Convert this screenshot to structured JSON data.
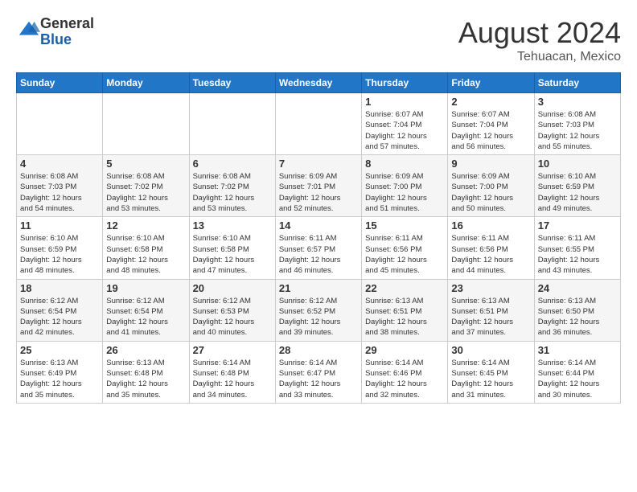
{
  "header": {
    "logo_general": "General",
    "logo_blue": "Blue",
    "title": "August 2024",
    "location": "Tehuacan, Mexico"
  },
  "weekdays": [
    "Sunday",
    "Monday",
    "Tuesday",
    "Wednesday",
    "Thursday",
    "Friday",
    "Saturday"
  ],
  "weeks": [
    [
      {
        "day": "",
        "info": ""
      },
      {
        "day": "",
        "info": ""
      },
      {
        "day": "",
        "info": ""
      },
      {
        "day": "",
        "info": ""
      },
      {
        "day": "1",
        "info": "Sunrise: 6:07 AM\nSunset: 7:04 PM\nDaylight: 12 hours\nand 57 minutes."
      },
      {
        "day": "2",
        "info": "Sunrise: 6:07 AM\nSunset: 7:04 PM\nDaylight: 12 hours\nand 56 minutes."
      },
      {
        "day": "3",
        "info": "Sunrise: 6:08 AM\nSunset: 7:03 PM\nDaylight: 12 hours\nand 55 minutes."
      }
    ],
    [
      {
        "day": "4",
        "info": "Sunrise: 6:08 AM\nSunset: 7:03 PM\nDaylight: 12 hours\nand 54 minutes."
      },
      {
        "day": "5",
        "info": "Sunrise: 6:08 AM\nSunset: 7:02 PM\nDaylight: 12 hours\nand 53 minutes."
      },
      {
        "day": "6",
        "info": "Sunrise: 6:08 AM\nSunset: 7:02 PM\nDaylight: 12 hours\nand 53 minutes."
      },
      {
        "day": "7",
        "info": "Sunrise: 6:09 AM\nSunset: 7:01 PM\nDaylight: 12 hours\nand 52 minutes."
      },
      {
        "day": "8",
        "info": "Sunrise: 6:09 AM\nSunset: 7:00 PM\nDaylight: 12 hours\nand 51 minutes."
      },
      {
        "day": "9",
        "info": "Sunrise: 6:09 AM\nSunset: 7:00 PM\nDaylight: 12 hours\nand 50 minutes."
      },
      {
        "day": "10",
        "info": "Sunrise: 6:10 AM\nSunset: 6:59 PM\nDaylight: 12 hours\nand 49 minutes."
      }
    ],
    [
      {
        "day": "11",
        "info": "Sunrise: 6:10 AM\nSunset: 6:59 PM\nDaylight: 12 hours\nand 48 minutes."
      },
      {
        "day": "12",
        "info": "Sunrise: 6:10 AM\nSunset: 6:58 PM\nDaylight: 12 hours\nand 48 minutes."
      },
      {
        "day": "13",
        "info": "Sunrise: 6:10 AM\nSunset: 6:58 PM\nDaylight: 12 hours\nand 47 minutes."
      },
      {
        "day": "14",
        "info": "Sunrise: 6:11 AM\nSunset: 6:57 PM\nDaylight: 12 hours\nand 46 minutes."
      },
      {
        "day": "15",
        "info": "Sunrise: 6:11 AM\nSunset: 6:56 PM\nDaylight: 12 hours\nand 45 minutes."
      },
      {
        "day": "16",
        "info": "Sunrise: 6:11 AM\nSunset: 6:56 PM\nDaylight: 12 hours\nand 44 minutes."
      },
      {
        "day": "17",
        "info": "Sunrise: 6:11 AM\nSunset: 6:55 PM\nDaylight: 12 hours\nand 43 minutes."
      }
    ],
    [
      {
        "day": "18",
        "info": "Sunrise: 6:12 AM\nSunset: 6:54 PM\nDaylight: 12 hours\nand 42 minutes."
      },
      {
        "day": "19",
        "info": "Sunrise: 6:12 AM\nSunset: 6:54 PM\nDaylight: 12 hours\nand 41 minutes."
      },
      {
        "day": "20",
        "info": "Sunrise: 6:12 AM\nSunset: 6:53 PM\nDaylight: 12 hours\nand 40 minutes."
      },
      {
        "day": "21",
        "info": "Sunrise: 6:12 AM\nSunset: 6:52 PM\nDaylight: 12 hours\nand 39 minutes."
      },
      {
        "day": "22",
        "info": "Sunrise: 6:13 AM\nSunset: 6:51 PM\nDaylight: 12 hours\nand 38 minutes."
      },
      {
        "day": "23",
        "info": "Sunrise: 6:13 AM\nSunset: 6:51 PM\nDaylight: 12 hours\nand 37 minutes."
      },
      {
        "day": "24",
        "info": "Sunrise: 6:13 AM\nSunset: 6:50 PM\nDaylight: 12 hours\nand 36 minutes."
      }
    ],
    [
      {
        "day": "25",
        "info": "Sunrise: 6:13 AM\nSunset: 6:49 PM\nDaylight: 12 hours\nand 35 minutes."
      },
      {
        "day": "26",
        "info": "Sunrise: 6:13 AM\nSunset: 6:48 PM\nDaylight: 12 hours\nand 35 minutes."
      },
      {
        "day": "27",
        "info": "Sunrise: 6:14 AM\nSunset: 6:48 PM\nDaylight: 12 hours\nand 34 minutes."
      },
      {
        "day": "28",
        "info": "Sunrise: 6:14 AM\nSunset: 6:47 PM\nDaylight: 12 hours\nand 33 minutes."
      },
      {
        "day": "29",
        "info": "Sunrise: 6:14 AM\nSunset: 6:46 PM\nDaylight: 12 hours\nand 32 minutes."
      },
      {
        "day": "30",
        "info": "Sunrise: 6:14 AM\nSunset: 6:45 PM\nDaylight: 12 hours\nand 31 minutes."
      },
      {
        "day": "31",
        "info": "Sunrise: 6:14 AM\nSunset: 6:44 PM\nDaylight: 12 hours\nand 30 minutes."
      }
    ]
  ]
}
